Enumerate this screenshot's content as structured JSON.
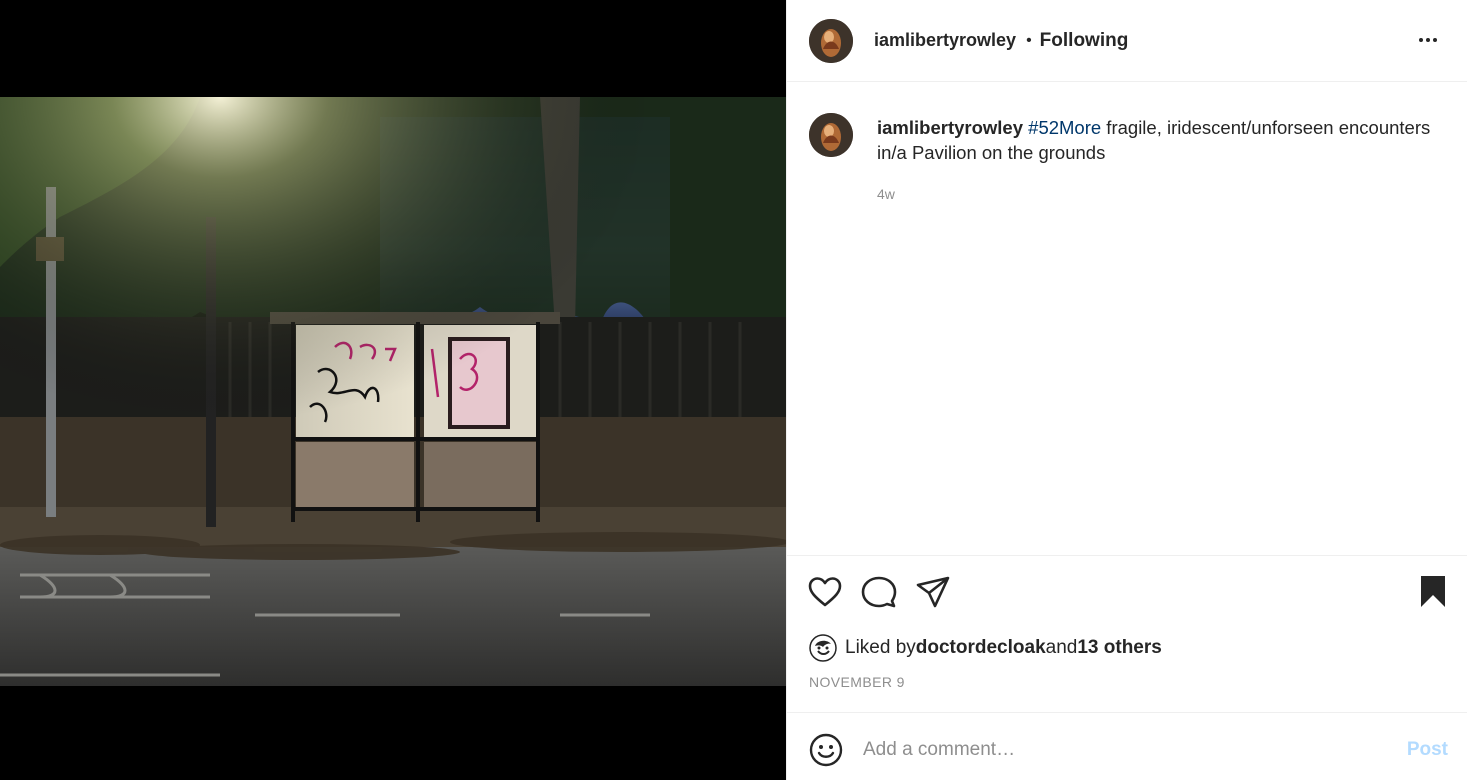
{
  "header": {
    "username": "iamlibertyrowley",
    "separator": "•",
    "follow_status": "Following",
    "more_icon": "more-horizontal-icon"
  },
  "caption": {
    "username": "iamlibertyrowley",
    "hashtag": "#52More",
    "text": " fragile, iridescent/unforseen encounters in/a Pavilion on the grounds",
    "time_ago": "4w"
  },
  "actions": {
    "icons": [
      "heart-icon",
      "comment-icon",
      "share-icon",
      "bookmark-icon"
    ]
  },
  "likes": {
    "prefix": "Liked by ",
    "liker": "doctordecloak",
    "middle": " and ",
    "others": "13 others"
  },
  "post_date": "NOVEMBER 9",
  "comment": {
    "placeholder": "Add a comment…",
    "post_label": "Post",
    "post_color": "#b3dbff"
  },
  "colors": {
    "text": "#262626",
    "muted": "#8e8e8e",
    "hashtag": "#00376b"
  }
}
